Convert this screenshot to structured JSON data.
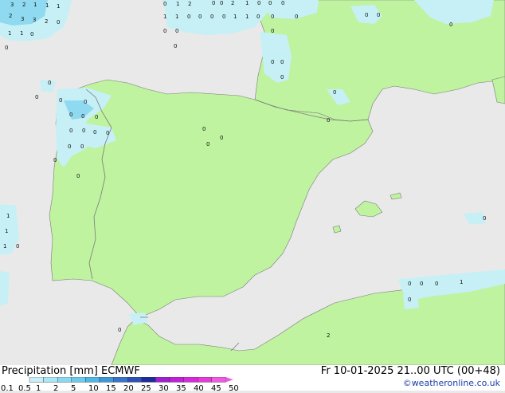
{
  "footer": {
    "title": "Precipitation [mm]  ECMWF",
    "datetime": "Fr 10-01-2025 21..00 UTC (00+48)",
    "credit": "©weatheronline.co.uk"
  },
  "legend": {
    "labels": [
      "0.1",
      "0.5",
      "1",
      "2",
      "5",
      "10",
      "15",
      "20",
      "25",
      "30",
      "35",
      "40",
      "45",
      "50"
    ],
    "colors": [
      "#c8f0f8",
      "#a9e6f6",
      "#8ad9f2",
      "#6ccbed",
      "#4db7e5",
      "#3f97d8",
      "#3a72c9",
      "#2e4fb6",
      "#1f2b9a",
      "#a020d0",
      "#c020d8",
      "#d828dc",
      "#e63ad8",
      "#f05ae0"
    ]
  },
  "map_colors": {
    "sea": "#e9e9e9",
    "land": "#bff3a0",
    "precip_light": "#c6f0f6",
    "precip_medium": "#8fdaf0",
    "border": "#7a7a7a"
  },
  "precip_labels": [
    "3",
    "2",
    "1",
    "1",
    "1",
    "2",
    "3",
    "3",
    "2",
    "0",
    "1",
    "1",
    "0",
    "0",
    "0",
    "1",
    "2",
    "0",
    "0",
    "2",
    "1",
    "0",
    "0",
    "0",
    "1",
    "1",
    "0",
    "0",
    "0",
    "0",
    "1",
    "1",
    "0",
    "0",
    "0",
    "0",
    "0",
    "0",
    "0",
    "0",
    "0",
    "0",
    "0",
    "0",
    "0",
    "0",
    "0",
    "0",
    "0",
    "0",
    "0",
    "0",
    "0",
    "0",
    "0",
    "0",
    "0",
    "0",
    "0",
    "0",
    "0",
    "0",
    "0",
    "0",
    "0",
    "1",
    "1",
    "1",
    "0",
    "0",
    "0",
    "0",
    "0",
    "0",
    "0",
    "2",
    "1"
  ]
}
